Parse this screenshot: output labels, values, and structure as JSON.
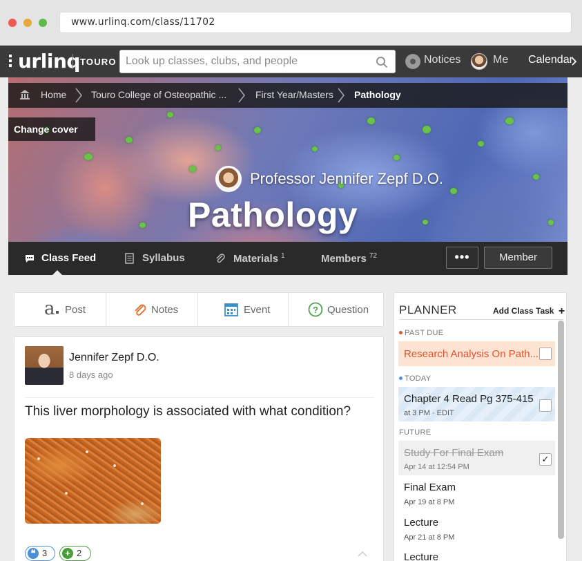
{
  "browser": {
    "url": "www.urlinq.com/class/11702"
  },
  "nav": {
    "logo": "urlinq",
    "school": "TOURO",
    "search_placeholder": "Look up classes, clubs, and people",
    "notices": "Notices",
    "me": "Me",
    "calendar": "Calendar"
  },
  "breadcrumb": {
    "home": "Home",
    "college": "Touro College of Osteopathic ...",
    "year": "First Year/Masters",
    "current": "Pathology"
  },
  "cover": {
    "change_cover": "Change cover",
    "professor": "Professor Jennifer Zepf D.O.",
    "class_title": "Pathology"
  },
  "tabs": {
    "class_feed": "Class Feed",
    "syllabus": "Syllabus",
    "materials": "Materials",
    "materials_count": "1",
    "members": "Members",
    "members_count": "72",
    "more": "•••",
    "member_button": "Member"
  },
  "composer": {
    "post": "Post",
    "notes": "Notes",
    "event": "Event",
    "question": "Question"
  },
  "post": {
    "author": "Jennifer Zepf D.O.",
    "time": "8 days ago",
    "question": "This liver morphology is associated with what condition?",
    "replies_count": "3",
    "plus_count": "2"
  },
  "planner": {
    "title": "PLANNER",
    "add_task": "Add Class Task",
    "sections": {
      "past_due": "PAST DUE",
      "today": "TODAY",
      "future": "FUTURE"
    },
    "past_due_tasks": [
      {
        "title": "Research Analysis On Path...",
        "checked": false
      }
    ],
    "today_tasks": [
      {
        "title": "Chapter 4 Read Pg 375-415",
        "sub": "at 3 PM · EDIT",
        "checked": false
      }
    ],
    "future_tasks": [
      {
        "title": "Study For Final Exam",
        "sub": "Apr 14 at 12:54 PM",
        "checked": true
      },
      {
        "title": "Final Exam",
        "sub": "Apr 19 at 8 PM"
      },
      {
        "title": "Lecture",
        "sub": "Apr 21 at 8 PM"
      },
      {
        "title": "Lecture"
      }
    ]
  },
  "colors": {
    "nav_bg": "#3a3a3a",
    "past_due_accent": "#e0532f",
    "today_accent": "#4a90d9",
    "blue_pill": "#4a90d9",
    "green_pill": "#4a9e3a"
  }
}
